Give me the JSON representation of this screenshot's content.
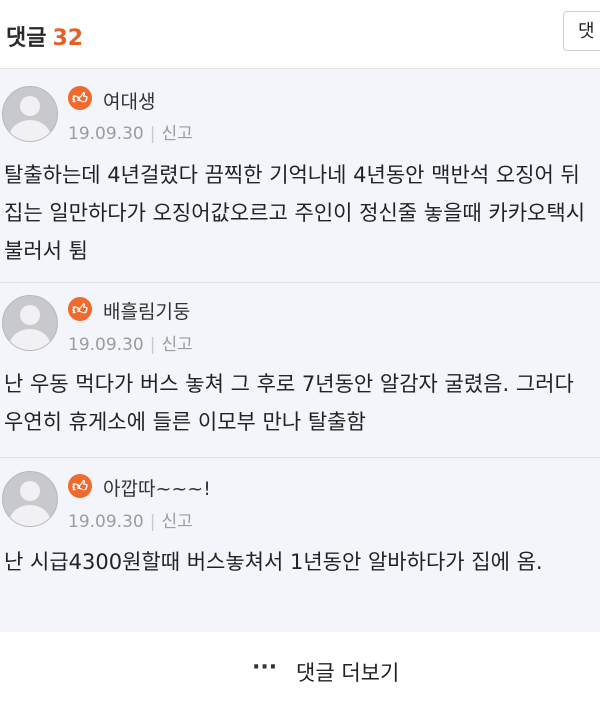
{
  "header": {
    "title": "댓글",
    "count": "32",
    "button_label": "댓"
  },
  "comments": [
    {
      "nickname": "여대생",
      "badge_icon": "thumbs-up-icon",
      "date": "19.09.30",
      "report": "신고",
      "text": "탈출하는데 4년걸렸다 끔찍한 기억나네 4년동안 맥반석 오징어 뒤집는 일만하다가 오징어값오르고 주인이 정신줄 놓을때 카카오택시 불러서 튐"
    },
    {
      "nickname": "배흘림기둥",
      "badge_icon": "thumbs-up-icon",
      "date": "19.09.30",
      "report": "신고",
      "text": "난 우동 먹다가 버스 놓쳐 그 후로 7년동안 알감자 굴렸음. 그러다 우연히 휴게소에 들른 이모부 만나 탈출함"
    },
    {
      "nickname": "아깝따~~~!",
      "badge_icon": "thumbs-up-icon",
      "date": "19.09.30",
      "report": "신고",
      "text": "난 시급4300원할때 버스놓쳐서 1년동안 알바하다가 집에 옴."
    }
  ],
  "more": {
    "dots": "···",
    "label": "댓글 더보기"
  },
  "colors": {
    "accent": "#e2622a",
    "badge": "#ef6a2c",
    "comment_bg": "#f3f5fa"
  }
}
